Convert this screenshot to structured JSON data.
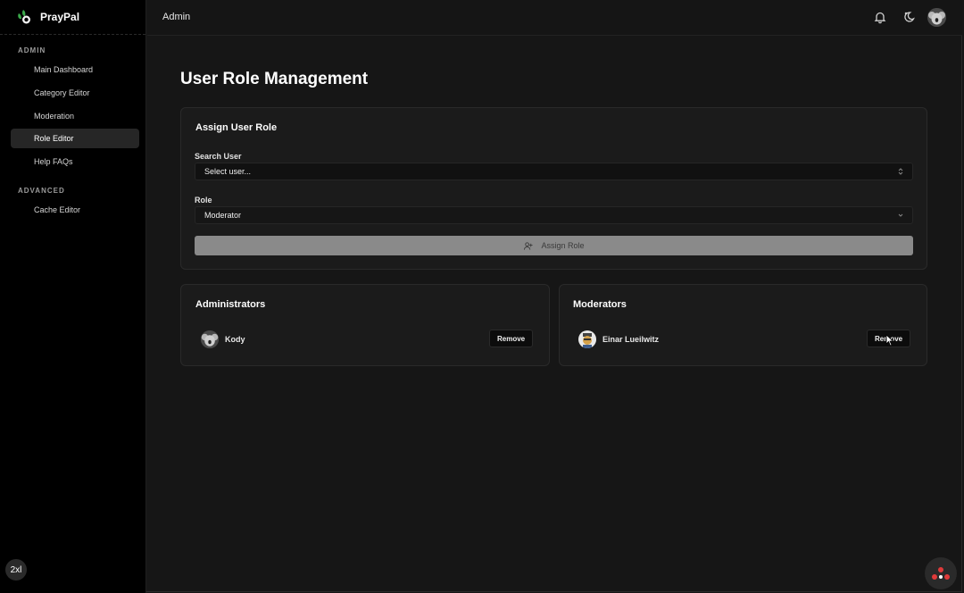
{
  "app": {
    "name": "PrayPal",
    "breadcrumb": "Admin"
  },
  "sidebar": {
    "sections": [
      {
        "label": "ADMIN",
        "items": [
          {
            "label": "Main Dashboard"
          },
          {
            "label": "Category Editor"
          },
          {
            "label": "Moderation"
          },
          {
            "label": "Role Editor",
            "active": true
          },
          {
            "label": "Help FAQs"
          }
        ]
      },
      {
        "label": "ADVANCED",
        "items": [
          {
            "label": "Cache Editor"
          }
        ]
      }
    ],
    "size_badge": "2xl"
  },
  "topbar": {
    "icons": [
      "bell-icon",
      "theme-toggle-icon",
      "user-avatar"
    ]
  },
  "page": {
    "title": "User Role Management",
    "assign_card": {
      "title": "Assign User Role",
      "search_label": "Search User",
      "search_placeholder": "Select user...",
      "role_label": "Role",
      "role_value": "Moderator",
      "assign_button": "Assign Role"
    },
    "admins_card": {
      "title": "Administrators",
      "users": [
        {
          "name": "Kody",
          "action": "Remove"
        }
      ]
    },
    "mods_card": {
      "title": "Moderators",
      "users": [
        {
          "name": "Einar Lueilwitz",
          "action": "Remove"
        }
      ]
    }
  },
  "colors": {
    "background": "#161616",
    "sidebar": "#000000",
    "card": "#1b1b1b",
    "assign_button": "#8a8a8a",
    "brand_green": "#3aa84a"
  }
}
